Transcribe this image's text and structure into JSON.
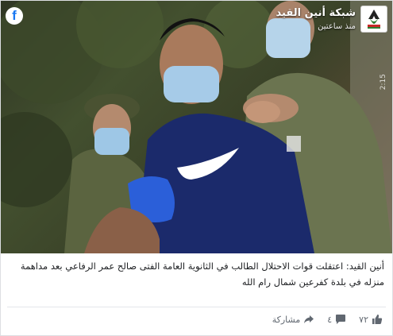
{
  "post": {
    "page_name": "شبكة أنين القيد",
    "time": "منذ ساعتين",
    "video_time": "2:15",
    "caption": "أنين القيد: اعتقلت قوات الاحتلال الطالب في الثانوية العامة الفتى صالح عمر الرفاعي بعد مداهمة منزله في بلدة كفرعين شمال رام الله"
  },
  "actions": {
    "likes_count": "٧٢",
    "comments_count": "٤",
    "share_label": "مشاركة"
  },
  "icons": {
    "facebook": "facebook-icon",
    "like": "thumbs-up-icon",
    "comment": "comment-bubble-icon",
    "share": "share-arrow-icon"
  },
  "colors": {
    "facebook_blue": "#1877f2",
    "text": "#1c1e21",
    "muted": "#606770"
  }
}
